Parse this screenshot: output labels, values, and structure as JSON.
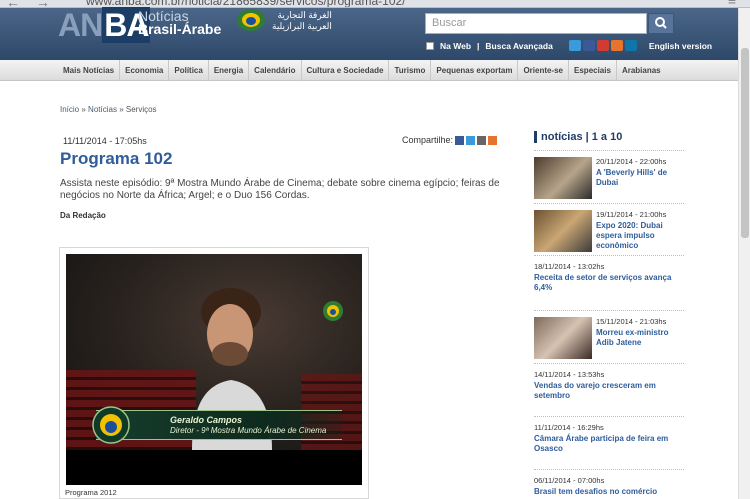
{
  "browser": {
    "url": "www.anba.com.br/noticia/21865839/servicos/programa-102/"
  },
  "header": {
    "logo_mark_a": "AN",
    "logo_mark_b": "BA",
    "logo_line1": "Notícias",
    "logo_line2": "Brasil-Árabe",
    "chamber_ar_line1": "الغرفة التجارية",
    "chamber_ar_line2": "العربية البرازيلية",
    "search_placeholder": "Buscar",
    "na_web": "Na Web",
    "busca_avancada": "Busca Avançada",
    "english": "English version",
    "social_colors": [
      "#3b9ad9",
      "#3b5998",
      "#d23b2f",
      "#e6742d",
      "#0e76a8"
    ]
  },
  "nav": {
    "items": [
      "Mais Notícias",
      "Economia",
      "Política",
      "Energia",
      "Calendário",
      "Cultura e Sociedade",
      "Turismo",
      "Pequenas exportam",
      "Oriente-se",
      "Especiais",
      "Arabianas"
    ]
  },
  "breadcrumb": {
    "home": "Início",
    "sep": "»",
    "news": "Notícias",
    "current": "Serviços"
  },
  "article": {
    "datetime": "11/11/2014 - 17:05hs",
    "share_label": "Compartilhe:",
    "title": "Programa 102",
    "description": "Assista neste episódio: 9ª Mostra Mundo Árabe de Cinema; debate sobre cinema egípcio; feiras de negócios no Norte da África; Argel; e o Duo 156 Cordas.",
    "byline": "Da Redação",
    "video_name": "Geraldo Campos",
    "video_role": "Diretor - 9ª Mostra Mundo Árabe de Cinema",
    "caption": "Programa 2012"
  },
  "sidebar": {
    "title": "notícias | 1 a 10",
    "items": [
      {
        "date": "20/11/2014 - 22:00hs",
        "headline": "A 'Beverly Hills' de Dubai",
        "has_thumb": true
      },
      {
        "date": "19/11/2014 - 21:00hs",
        "headline": "Expo 2020: Dubai espera impulso econômico",
        "has_thumb": true
      },
      {
        "date": "18/11/2014 - 13:02hs",
        "headline": "Receita de setor de serviços avança 6,4%",
        "has_thumb": false
      },
      {
        "date": "15/11/2014 - 21:03hs",
        "headline": "Morreu ex-ministro Adib Jatene",
        "has_thumb": true
      },
      {
        "date": "14/11/2014 - 13:53hs",
        "headline": "Vendas do varejo cresceram em setembro",
        "has_thumb": false
      },
      {
        "date": "11/11/2014 - 16:29hs",
        "headline": "Câmara Árabe participa de feira em Osasco",
        "has_thumb": false
      },
      {
        "date": "06/11/2014 - 07:00hs",
        "headline": "Brasil tem desafios no comércio",
        "has_thumb": false
      }
    ]
  }
}
